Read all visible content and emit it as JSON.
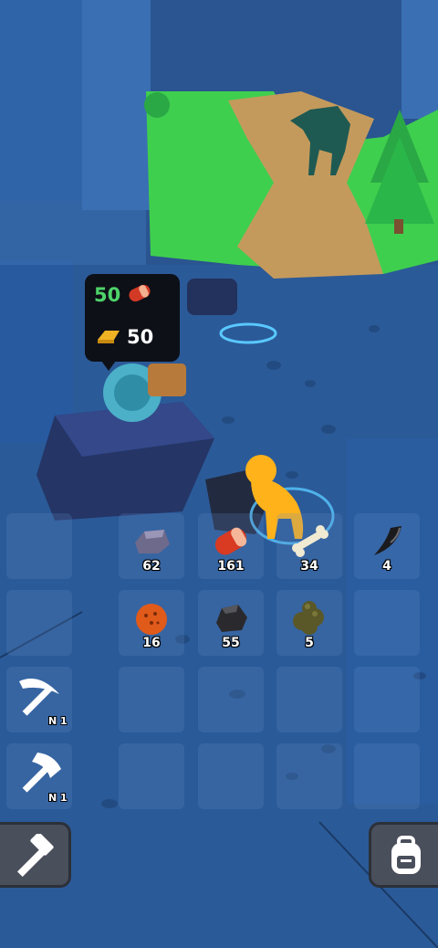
{
  "price_tag": {
    "meat_amount": "50",
    "gold_amount": "50",
    "meat_color": "#4ed36a",
    "gold_color": "#ffffff"
  },
  "inventory": {
    "rows": [
      [
        {
          "item": "",
          "count": ""
        },
        {
          "item": "stone-icon",
          "count": "62"
        },
        {
          "item": "meat-icon",
          "count": "161"
        },
        {
          "item": "bone-icon",
          "count": "34"
        },
        {
          "item": "claw-icon",
          "count": "4"
        }
      ],
      [
        {
          "item": "",
          "count": ""
        },
        {
          "item": "orange-ore-icon",
          "count": "16"
        },
        {
          "item": "coal-icon",
          "count": "55"
        },
        {
          "item": "dung-icon",
          "count": "5"
        },
        {
          "item": "",
          "count": ""
        }
      ]
    ],
    "tools": [
      {
        "item": "pickaxe-icon",
        "level": "N 1"
      },
      {
        "item": "axe-icon",
        "level": "N 1"
      }
    ]
  },
  "buttons": {
    "craft_icon": "hammer-icon",
    "backpack_icon": "backpack-icon"
  }
}
